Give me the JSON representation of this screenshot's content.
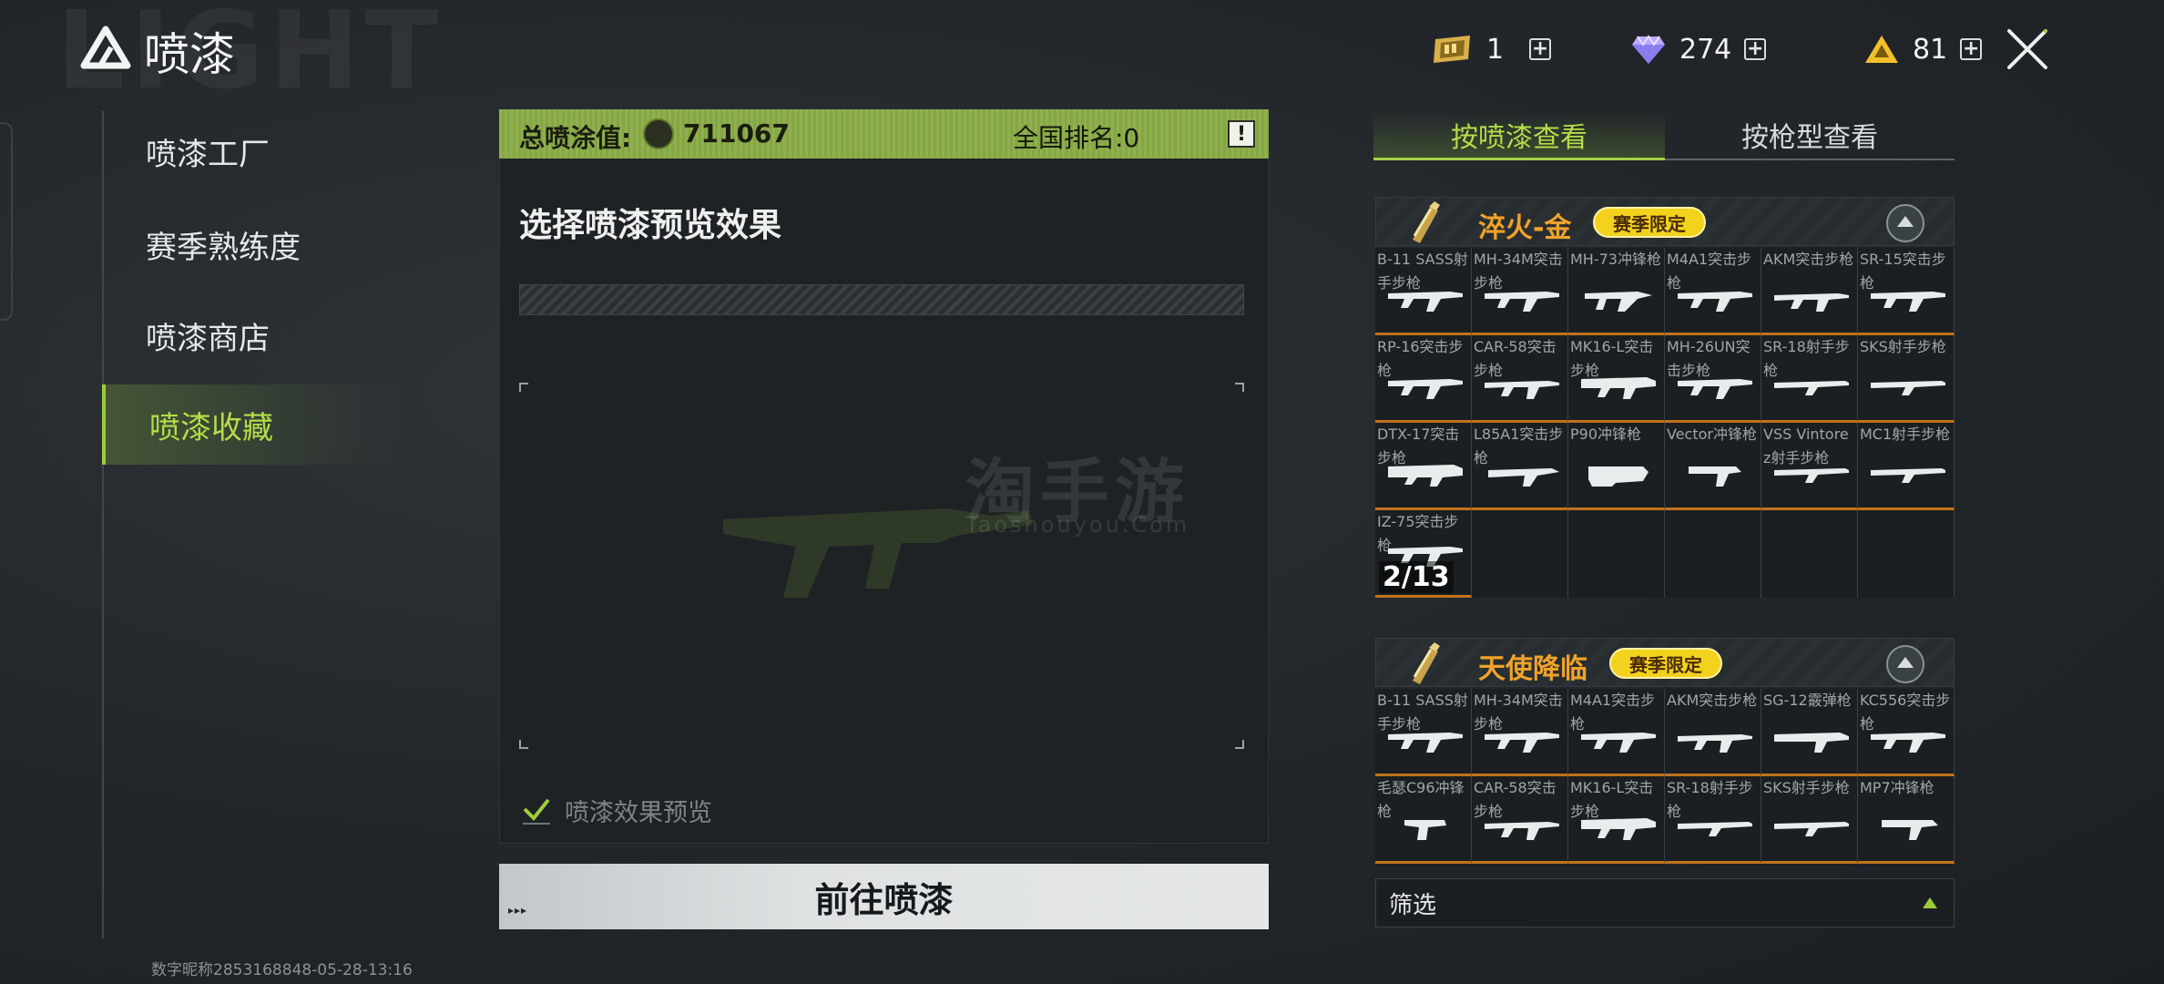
{
  "header": {
    "bg_word": "LIGHT",
    "title": "喷漆",
    "currencies": [
      {
        "icon": "ticket-icon",
        "amount": "1"
      },
      {
        "icon": "diamond-icon",
        "amount": "274"
      },
      {
        "icon": "gold-triangle-icon",
        "amount": "81"
      }
    ],
    "plus": "+"
  },
  "sidebar": {
    "items": [
      {
        "label": "喷漆工厂",
        "active": false
      },
      {
        "label": "赛季熟练度",
        "active": false
      },
      {
        "label": "喷漆商店",
        "active": false
      },
      {
        "label": "喷漆收藏",
        "active": true
      }
    ],
    "footer": "数字昵称2853168848-05-28-13:16"
  },
  "center": {
    "score_label": "总喷涂值:",
    "score_value": "711067",
    "rank_label": "全国排名:0",
    "info": "!",
    "preview_title": "选择喷漆预览效果",
    "watermark": "淘手游",
    "watermark_sub": "Taoshouyou.Com",
    "preview_toggle_label": "喷漆效果预览",
    "preview_toggle_checked": true,
    "go_button": "前往喷漆",
    "go_button_deco": "▸▸▸"
  },
  "right": {
    "tabs": [
      {
        "label": "按喷漆查看",
        "active": true
      },
      {
        "label": "按枪型查看",
        "active": false
      }
    ],
    "groups": [
      {
        "name": "淬火-金",
        "badge": "赛季限定",
        "progress": "2/13",
        "weapons": [
          "B-11 SASS射手步枪",
          "MH-34M突击步枪",
          "MH-73冲锋枪",
          "M4A1突击步枪",
          "AKM突击步枪",
          "SR-15突击步枪",
          "RP-16突击步枪",
          "CAR-58突击步枪",
          "MK16-L突击步枪",
          "MH-26UN突击步枪",
          "SR-18射手步枪",
          "SKS射手步枪",
          "DTX-17突击步枪",
          "L85A1突击步枪",
          "P90冲锋枪",
          "Vector冲锋枪",
          "VSS Vintorez射手步枪",
          "MC1射手步枪",
          "IZ-75突击步枪"
        ]
      },
      {
        "name": "天使降临",
        "badge": "赛季限定",
        "weapons": [
          "B-11 SASS射手步枪",
          "MH-34M突击步枪",
          "M4A1突击步枪",
          "AKM突击步枪",
          "SG-12霰弹枪",
          "KC556突击步枪",
          "毛瑟C96冲锋枪",
          "CAR-58突击步枪",
          "MK16-L突击步枪",
          "SR-18射手步枪",
          "SKS射手步枪",
          "MP7冲锋枪"
        ]
      }
    ],
    "filter_label": "筛选"
  },
  "colors": {
    "accent_green": "#9ccc3a",
    "gold_text": "#f0a32a",
    "badge_yellow": "#f3d21e",
    "cell_border_orange": "#c2721c"
  }
}
